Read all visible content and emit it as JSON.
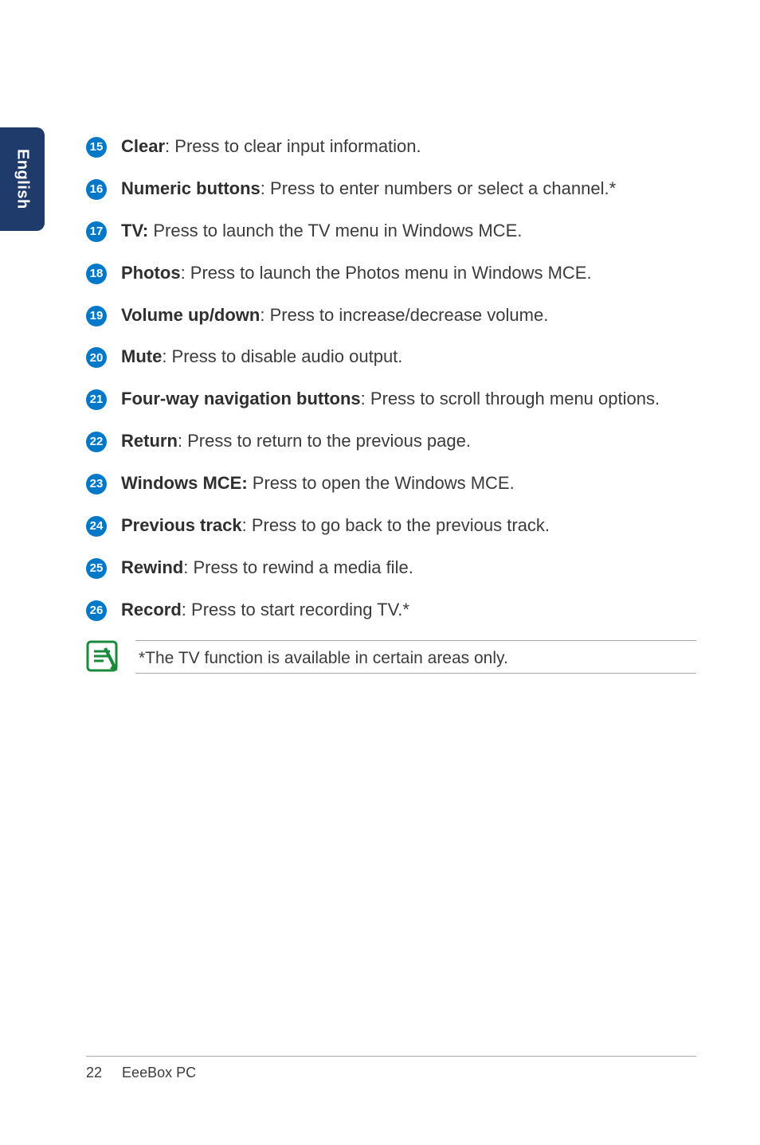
{
  "sideTab": "English",
  "items": [
    {
      "num": "15",
      "bold": "Clear",
      "rest": ": Press to clear input information."
    },
    {
      "num": "16",
      "bold": "Numeric buttons",
      "rest": ": Press to enter numbers or select a channel.*"
    },
    {
      "num": "17",
      "bold": "TV:",
      "rest": " Press to launch the TV menu in Windows MCE."
    },
    {
      "num": "18",
      "bold": "Photos",
      "rest": ": Press to launch the Photos menu in Windows MCE."
    },
    {
      "num": "19",
      "bold": "Volume up/down",
      "rest": ": Press to increase/decrease volume."
    },
    {
      "num": "20",
      "bold": "Mute",
      "rest": ": Press to disable audio output."
    },
    {
      "num": "21",
      "bold": "Four-way navigation buttons",
      "rest": ": Press to scroll through menu options."
    },
    {
      "num": "22",
      "bold": "Return",
      "rest": ": Press to return to the previous page."
    },
    {
      "num": "23",
      "bold": "Windows MCE:",
      "rest": " Press to open the Windows MCE."
    },
    {
      "num": "24",
      "bold": "Previous track",
      "rest": ": Press to go back to the previous track."
    },
    {
      "num": "25",
      "bold": "Rewind",
      "rest": ": Press to rewind a media file."
    },
    {
      "num": "26",
      "bold": "Record",
      "rest": ": Press to start recording TV.*"
    }
  ],
  "note": "*The TV function is available in certain areas only.",
  "footer": {
    "pageNum": "22",
    "title": "EeeBox PC"
  }
}
